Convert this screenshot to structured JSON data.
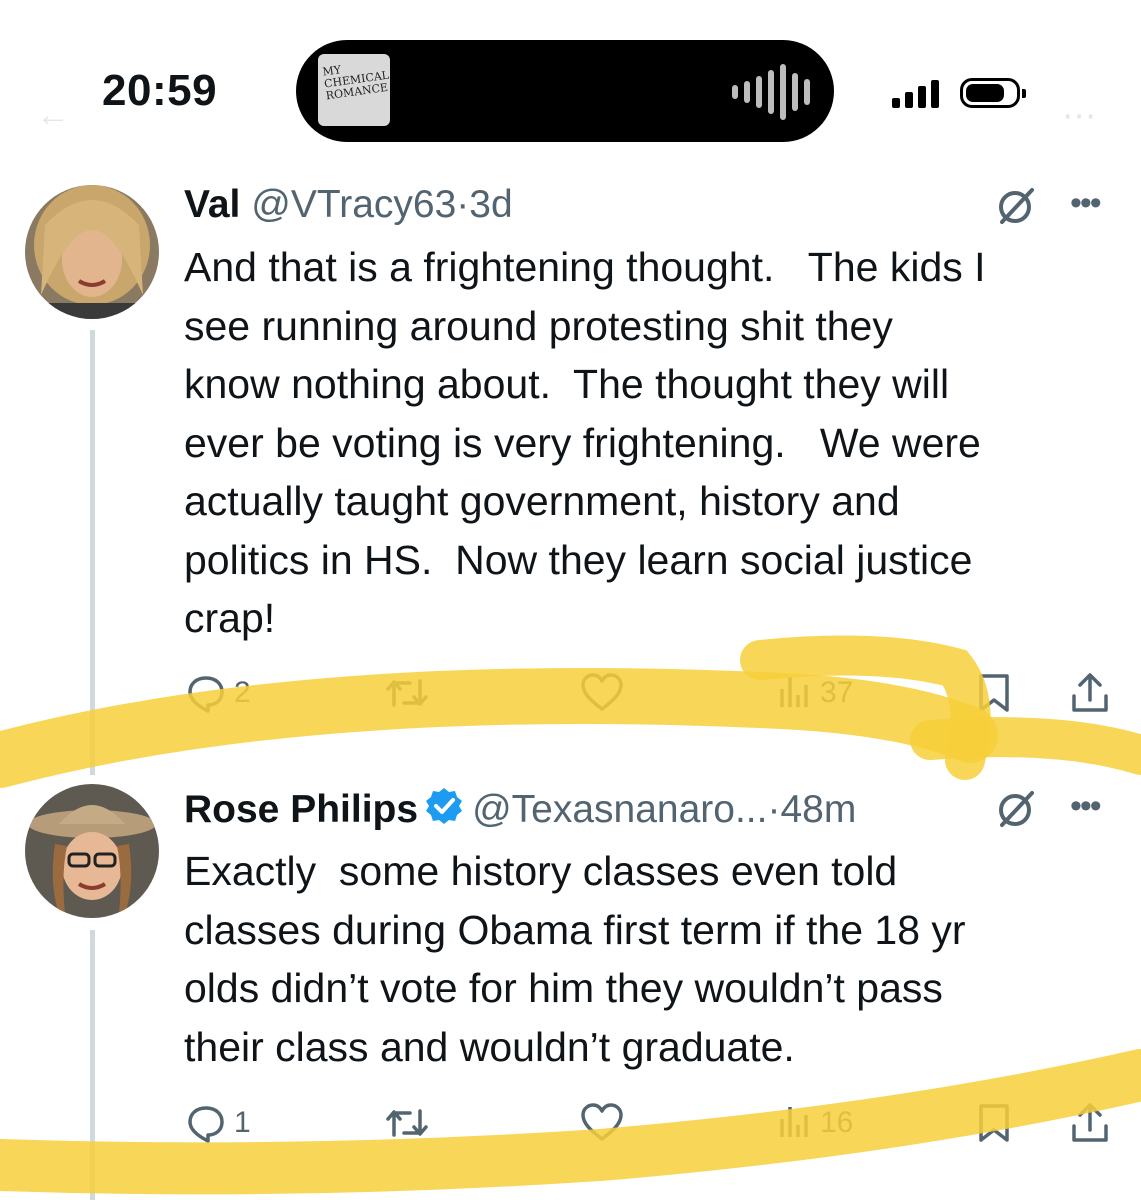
{
  "status_bar": {
    "time": "20:59",
    "album_art_text": "MY CHEMICAL ROMANCE",
    "icons": [
      "signal-bars-icon",
      "battery-icon",
      "waveform-icon"
    ]
  },
  "tweets": [
    {
      "name": "Val",
      "handle": "@VTracy63",
      "separator": "·",
      "time_ago": "3d",
      "verified": false,
      "text": "And that is a frightening thought.   The kids I\nsee running around protesting shit they\nknow nothing about.  The thought they will\never be voting is very frightening.   We were\nactually taught government, history and\npolitics in HS.  Now they learn social justice\ncrap!",
      "reply_count": "2",
      "retweet_count": "",
      "like_count": "",
      "view_count": "37"
    },
    {
      "name": "Rose Philips",
      "handle": "@Texasnanaro...",
      "separator": "·",
      "time_ago": "48m",
      "verified": true,
      "text": "Exactly  some history classes even told\nclasses during Obama first term if the 18 yr\nolds didn’t vote for him they wouldn’t pass\ntheir class and wouldn’t graduate.",
      "reply_count": "1",
      "retweet_count": "",
      "like_count": "",
      "view_count": "16"
    }
  ],
  "colors": {
    "text": "#0f1419",
    "secondary": "#536471",
    "verified_blue": "#1d9bf0",
    "highlighter": "#f7cf3a"
  }
}
